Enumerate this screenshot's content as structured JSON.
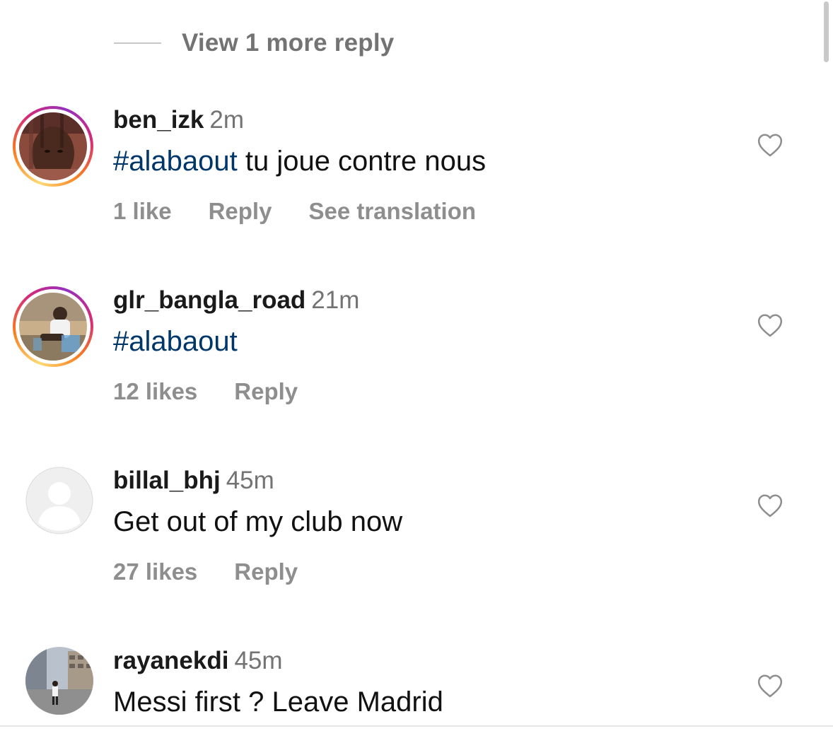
{
  "view_more": {
    "label": "View 1 more reply"
  },
  "comments": [
    {
      "username": "ben_izk",
      "time": "2m",
      "hashtag": "#alabaout",
      "text": " tu joue contre nous",
      "likes": "1 like",
      "reply": "Reply",
      "translate": "See translation"
    },
    {
      "username": "glr_bangla_road",
      "time": "21m",
      "hashtag": "#alabaout",
      "text": "",
      "likes": "12 likes",
      "reply": "Reply"
    },
    {
      "username": "billal_bhj",
      "time": "45m",
      "hashtag": "",
      "text": "Get out of my club now",
      "likes": "27 likes",
      "reply": "Reply"
    },
    {
      "username": "rayanekdi",
      "time": "45m",
      "hashtag": "",
      "text": "Messi first ? Leave Madrid"
    }
  ],
  "icons": {
    "like": "heart-outline-icon",
    "default_avatar": "default-avatar-icon"
  },
  "colors": {
    "hashtag": "#00376b",
    "meta": "#8e8e8e",
    "story_ring_start": "#feda75",
    "story_ring_end": "#962fbf"
  }
}
